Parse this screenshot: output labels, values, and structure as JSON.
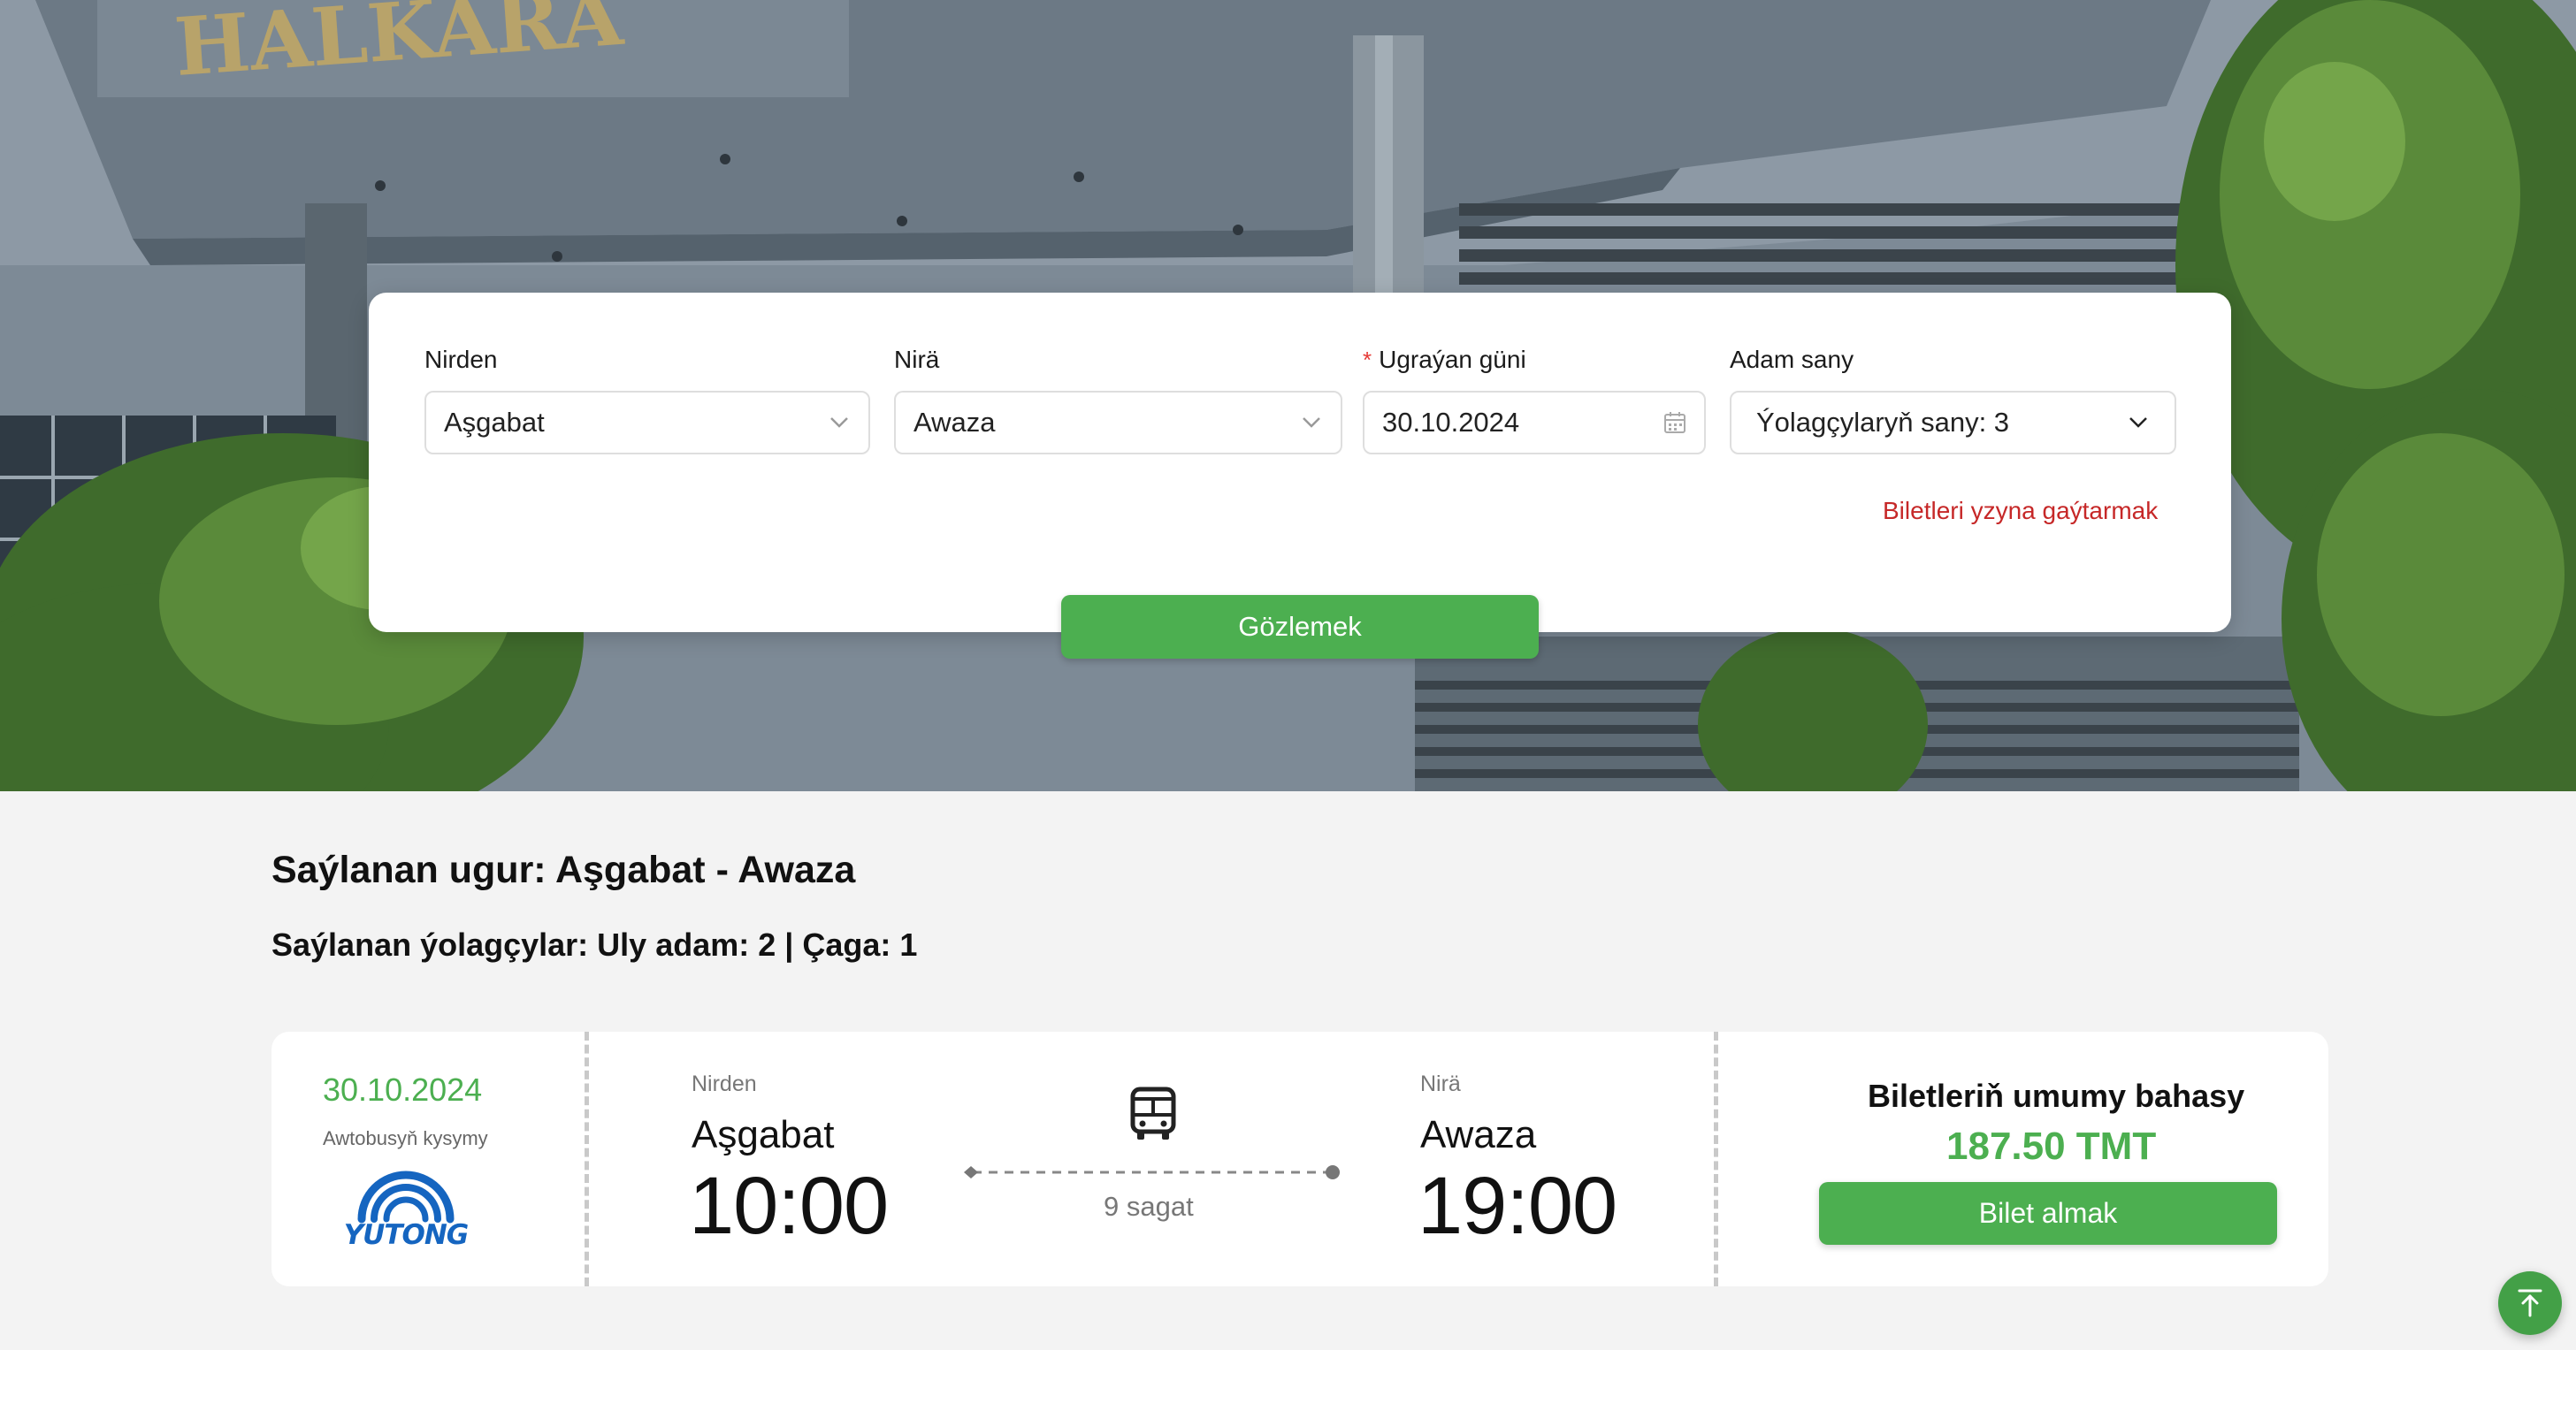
{
  "hero": {
    "sign_text": "HALKARA"
  },
  "search": {
    "from_label": "Nirden",
    "from_value": "Aşgabat",
    "to_label": "Nirä",
    "to_value": "Awaza",
    "date_required_mark": "*",
    "date_label": "Ugraýan güni",
    "date_value": "30.10.2024",
    "passengers_label": "Adam sany",
    "passengers_value": "Ýolagçylaryň sany: 3",
    "return_link": "Biletleri yzyna gaýtarmak",
    "search_button": "Gözlemek"
  },
  "summary": {
    "route_title": "Saýlanan ugur: Aşgabat - Awaza",
    "passengers_text": "Saýlanan ýolagçylar: Uly adam: 2 | Çaga: 1"
  },
  "ticket": {
    "date": "30.10.2024",
    "company_label": "Awtobusyň kysymy",
    "company_logo_text": "YUTONG",
    "from_label": "Nirden",
    "from_city": "Aşgabat",
    "departure_time": "10:00",
    "duration": "9 sagat",
    "to_label": "Nirä",
    "to_city": "Awaza",
    "arrival_time": "19:00",
    "price_label": "Biletleriň umumy bahasy",
    "price": "187.50 TMT",
    "buy_button": "Bilet almak"
  },
  "colors": {
    "accent": "#4caf50",
    "link_red": "#c62828",
    "logo_blue": "#1565c0"
  },
  "icons": {
    "from_chevron": "chevron-down-icon",
    "to_chevron": "chevron-down-icon",
    "date_picker": "calendar-icon",
    "passengers_chevron": "chevron-down-icon",
    "bus": "bus-icon",
    "scroll_top": "arrow-to-top-icon"
  }
}
